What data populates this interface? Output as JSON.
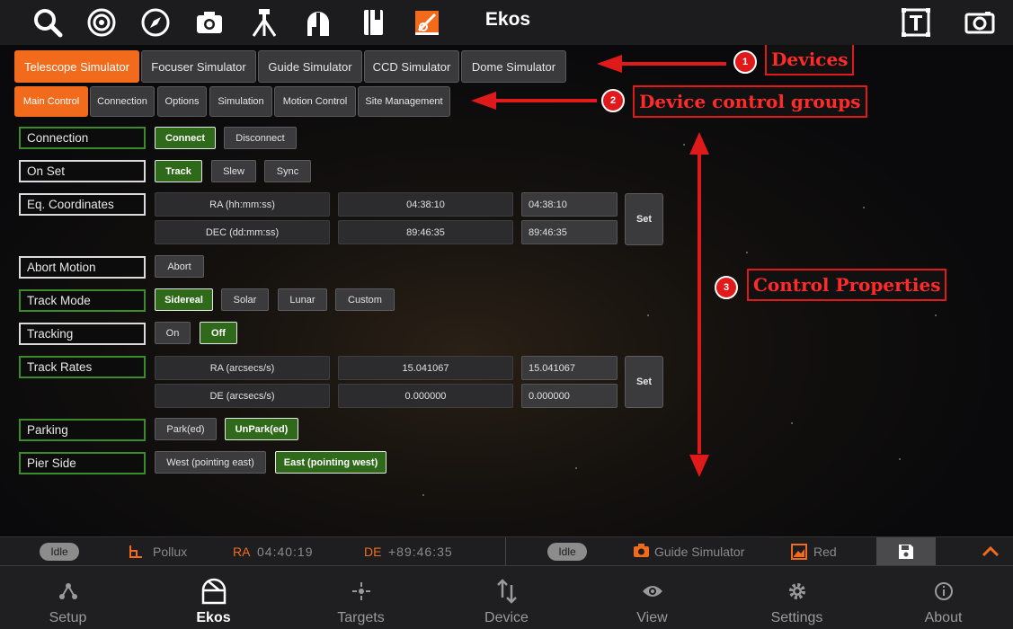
{
  "app": {
    "title": "Ekos"
  },
  "toolbar": {
    "icons": [
      "search-icon",
      "target-icon",
      "compass-icon",
      "camera-icon",
      "tripod-icon",
      "observatory-icon",
      "notebook-icon",
      "ekos-logo-icon"
    ],
    "right_icons": [
      "text-overlay-icon",
      "screenshot-icon"
    ]
  },
  "device_tabs": [
    {
      "label": "Telescope Simulator",
      "active": true
    },
    {
      "label": "Focuser Simulator",
      "active": false
    },
    {
      "label": "Guide Simulator",
      "active": false
    },
    {
      "label": "CCD Simulator",
      "active": false
    },
    {
      "label": "Dome Simulator",
      "active": false
    }
  ],
  "group_tabs": [
    {
      "label": "Main Control",
      "active": true
    },
    {
      "label": "Connection",
      "active": false
    },
    {
      "label": "Options",
      "active": false
    },
    {
      "label": "Simulation",
      "active": false
    },
    {
      "label": "Motion Control",
      "active": false
    },
    {
      "label": "Site Management",
      "active": false
    }
  ],
  "properties": {
    "connection": {
      "label": "Connection",
      "connect": "Connect",
      "disconnect": "Disconnect"
    },
    "on_set": {
      "label": "On Set",
      "track": "Track",
      "slew": "Slew",
      "sync": "Sync"
    },
    "eq_coords": {
      "label": "Eq. Coordinates",
      "ra_label": "RA (hh:mm:ss)",
      "ra_value": "04:38:10",
      "ra_input": "04:38:10",
      "dec_label": "DEC (dd:mm:ss)",
      "dec_value": "89:46:35",
      "dec_input": "89:46:35",
      "set": "Set"
    },
    "abort": {
      "label": "Abort Motion",
      "abort": "Abort"
    },
    "track_mode": {
      "label": "Track Mode",
      "sidereal": "Sidereal",
      "solar": "Solar",
      "lunar": "Lunar",
      "custom": "Custom"
    },
    "tracking": {
      "label": "Tracking",
      "on": "On",
      "off": "Off"
    },
    "track_rates": {
      "label": "Track Rates",
      "ra_label": "RA (arcsecs/s)",
      "ra_value": "15.041067",
      "ra_input": "15.041067",
      "de_label": "DE (arcsecs/s)",
      "de_value": "0.000000",
      "de_input": "0.000000",
      "set": "Set"
    },
    "parking": {
      "label": "Parking",
      "parked": "Park(ed)",
      "unparked": "UnPark(ed)"
    },
    "pier_side": {
      "label": "Pier Side",
      "west": "West (pointing east)",
      "east": "East (pointing west)"
    }
  },
  "annotations": [
    {
      "num": "1",
      "text": "Devices"
    },
    {
      "num": "2",
      "text": "Device control groups"
    },
    {
      "num": "3",
      "text": "Control Properties"
    }
  ],
  "status_bar": {
    "mount_state": "Idle",
    "target": "Pollux",
    "ra_label": "RA",
    "ra_value": "04:40:19",
    "de_label": "DE",
    "de_value": "+89:46:35",
    "camera_state": "Idle",
    "camera": "Guide Simulator",
    "filter": "Red"
  },
  "bottom_nav": [
    {
      "label": "Setup",
      "icon": "setup-icon",
      "active": false
    },
    {
      "label": "Ekos",
      "icon": "ekos-dome-icon",
      "active": true
    },
    {
      "label": "Targets",
      "icon": "targets-icon",
      "active": false
    },
    {
      "label": "Device",
      "icon": "device-arrows-icon",
      "active": false
    },
    {
      "label": "View",
      "icon": "eye-icon",
      "active": false
    },
    {
      "label": "Settings",
      "icon": "gear-icon",
      "active": false
    },
    {
      "label": "About",
      "icon": "info-icon",
      "active": false
    }
  ],
  "colors": {
    "accent": "#f26b1d",
    "active_green": "#2f6a1a",
    "annotation_red": "#e01a1a"
  }
}
